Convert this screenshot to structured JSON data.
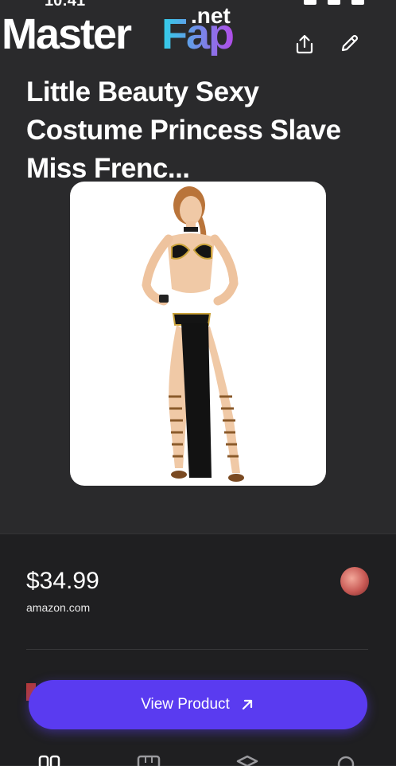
{
  "status_bar": {
    "time": "10:41",
    "icons": [
      "signal-icon",
      "wifi-icon",
      "battery-icon"
    ]
  },
  "watermark": {
    "brand_main": "Master",
    "brand_accent": "Fap",
    "brand_tld": ".net"
  },
  "header": {
    "actions": [
      "share-icon",
      "edit-icon"
    ]
  },
  "product": {
    "title": "Little Beauty Sexy Costume Princess Slave Miss Frenc...",
    "price": "$34.99",
    "store": "amazon.com"
  },
  "cta": {
    "label": "View Product",
    "icon": "arrow-up-right-icon",
    "color": "#5a3bf0"
  },
  "tab_bar": {
    "icons": [
      "grid-icon",
      "store-icon",
      "stack-icon",
      "search-icon"
    ]
  },
  "colors": {
    "background": "#2a2a2c",
    "panel": "#1f1f21",
    "accent": "#5a3bf0"
  }
}
